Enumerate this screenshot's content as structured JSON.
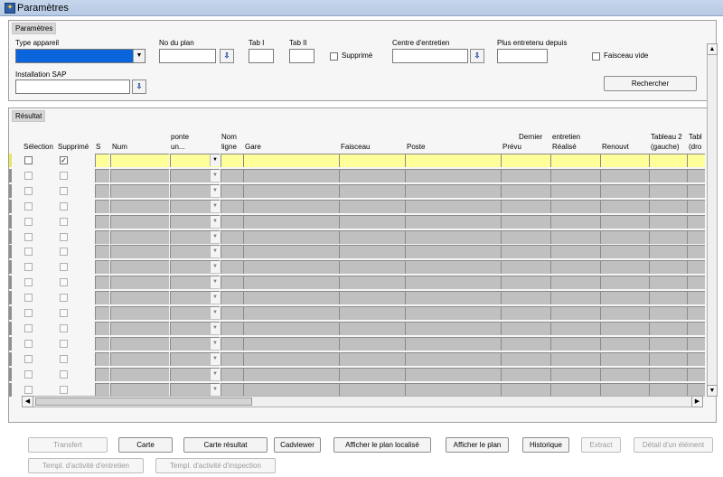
{
  "window": {
    "title": "Paramètres"
  },
  "params": {
    "section_label": "Paramètres",
    "type_appareil_label": "Type appareil",
    "no_plan_label": "No du plan",
    "tab1_label": "Tab I",
    "tab2_label": "Tab II",
    "supprime_label": "Supprimé",
    "centre_label": "Centre d'entretien",
    "plus_entretenu_label": "Plus entretenu depuis",
    "faisceau_vide_label": "Faisceau vide",
    "installation_sap_label": "Installation SAP",
    "search_button": "Rechercher"
  },
  "result": {
    "section_label": "Résultat",
    "columns": {
      "selection": "Sélection",
      "supprime": "Supprimé",
      "s": "S",
      "num": "Num",
      "ponte_1": "ponte",
      "ponte_2": "un...",
      "nom_1": "Nom",
      "nom_2": "ligne",
      "gare": "Gare",
      "faisceau": "Faisceau",
      "poste": "Poste",
      "dernier": "Dernier",
      "prevu": "Prévu",
      "entretien": "entretien",
      "realise": "Réalisé",
      "renouvt": "Renouvt",
      "tableau2_1": "Tableau 2",
      "tableau2_2": "(gauche)",
      "tabl_1": "Tabl",
      "tabl_2": "(dro"
    },
    "row_count": 16,
    "first_row_supprime_checked": true
  },
  "icons": {
    "lov": "download-arrow-icon",
    "dropdown": "chevron-down-icon",
    "scroll_up": "arrow-up-icon",
    "scroll_down": "arrow-down-icon",
    "scroll_left": "arrow-left-icon",
    "scroll_right": "arrow-right-icon"
  },
  "colors": {
    "selected_field": "#0a64dc",
    "active_row": "#ffff99",
    "grid_cell": "#c0c0c0"
  },
  "buttons": {
    "transfert": "Transfert",
    "carte": "Carte",
    "carte_resultat": "Carte résultat",
    "cadviewer": "Cadviewer",
    "afficher_plan_localise": "Afficher le plan localisé",
    "afficher_plan": "Afficher le plan",
    "historique": "Historique",
    "extract": "Extract",
    "detail_element": "Détail d'un élément",
    "templ_entretien": "Templ. d'activité d'entretien",
    "templ_inspection": "Templ. d'activité d'inspection"
  }
}
